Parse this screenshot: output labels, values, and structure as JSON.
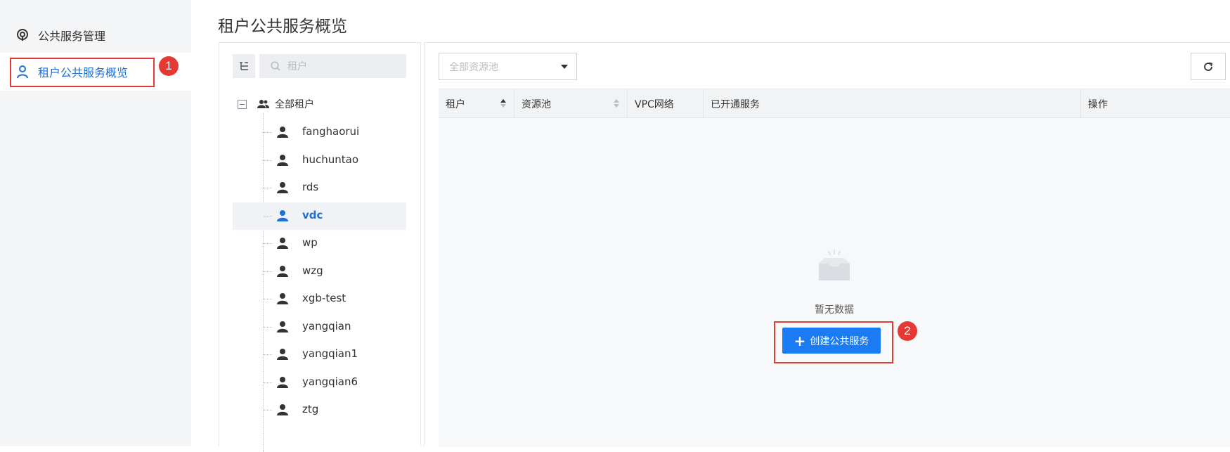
{
  "sidebar": {
    "items": [
      {
        "label": "公共服务管理",
        "icon": "service-icon"
      },
      {
        "label": "租户公共服务概览",
        "icon": "user-icon"
      }
    ]
  },
  "annotations": [
    {
      "number": "1"
    },
    {
      "number": "2"
    }
  ],
  "page": {
    "title": "租户公共服务概览"
  },
  "tree": {
    "search_placeholder": "租户",
    "root_label": "全部租户",
    "items": [
      {
        "label": "fanghaorui"
      },
      {
        "label": "huchuntao"
      },
      {
        "label": "rds"
      },
      {
        "label": "vdc",
        "selected": true
      },
      {
        "label": "wp"
      },
      {
        "label": "wzg"
      },
      {
        "label": "xgb-test"
      },
      {
        "label": "yangqian"
      },
      {
        "label": "yangqian1"
      },
      {
        "label": "yangqian6"
      },
      {
        "label": "ztg"
      }
    ]
  },
  "main": {
    "pool_select": {
      "value": "全部资源池"
    },
    "table": {
      "columns": [
        "租户",
        "资源池",
        "VPC网络",
        "已开通服务",
        "操作"
      ]
    },
    "empty_text": "暂无数据",
    "create_button": "创建公共服务"
  },
  "colors": {
    "accent": "#1f6fd6",
    "button": "#1b7bf2",
    "annotation": "#e53935"
  }
}
